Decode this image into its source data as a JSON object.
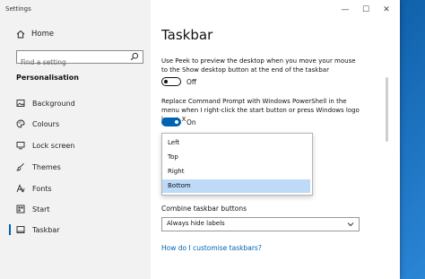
{
  "window": {
    "title": "Settings",
    "controls": {
      "minimize": "—",
      "maximize": "☐",
      "close": "✕"
    }
  },
  "sidebar": {
    "home_label": "Home",
    "search_placeholder": "Find a setting",
    "section_heading": "Personalisation",
    "items": [
      {
        "label": "Background",
        "icon": "image-icon"
      },
      {
        "label": "Colours",
        "icon": "palette-icon"
      },
      {
        "label": "Lock screen",
        "icon": "monitor-icon"
      },
      {
        "label": "Themes",
        "icon": "brush-icon"
      },
      {
        "label": "Fonts",
        "icon": "font-icon"
      },
      {
        "label": "Start",
        "icon": "start-icon"
      },
      {
        "label": "Taskbar",
        "icon": "taskbar-icon",
        "selected": true
      }
    ]
  },
  "main": {
    "title": "Taskbar",
    "peek_description": "Use Peek to preview the desktop when you move your mouse to the Show desktop button at the end of the taskbar",
    "peek_toggle_label": "Off",
    "powershell_description": "Replace Command Prompt with Windows PowerShell in the menu when I right-click the start button or press Windows logo key + X",
    "powershell_toggle_label": "On",
    "location_options": [
      "Left",
      "Top",
      "Right",
      "Bottom"
    ],
    "location_selected": "Bottom",
    "combine_label": "Combine taskbar buttons",
    "combine_value": "Always hide labels",
    "help_link": "How do I customise taskbars?"
  },
  "colors": {
    "accent": "#0063b1",
    "selection": "#bddbf7",
    "sidebar_bg": "#f2f2f2",
    "desktop": "#1b6fb8"
  }
}
